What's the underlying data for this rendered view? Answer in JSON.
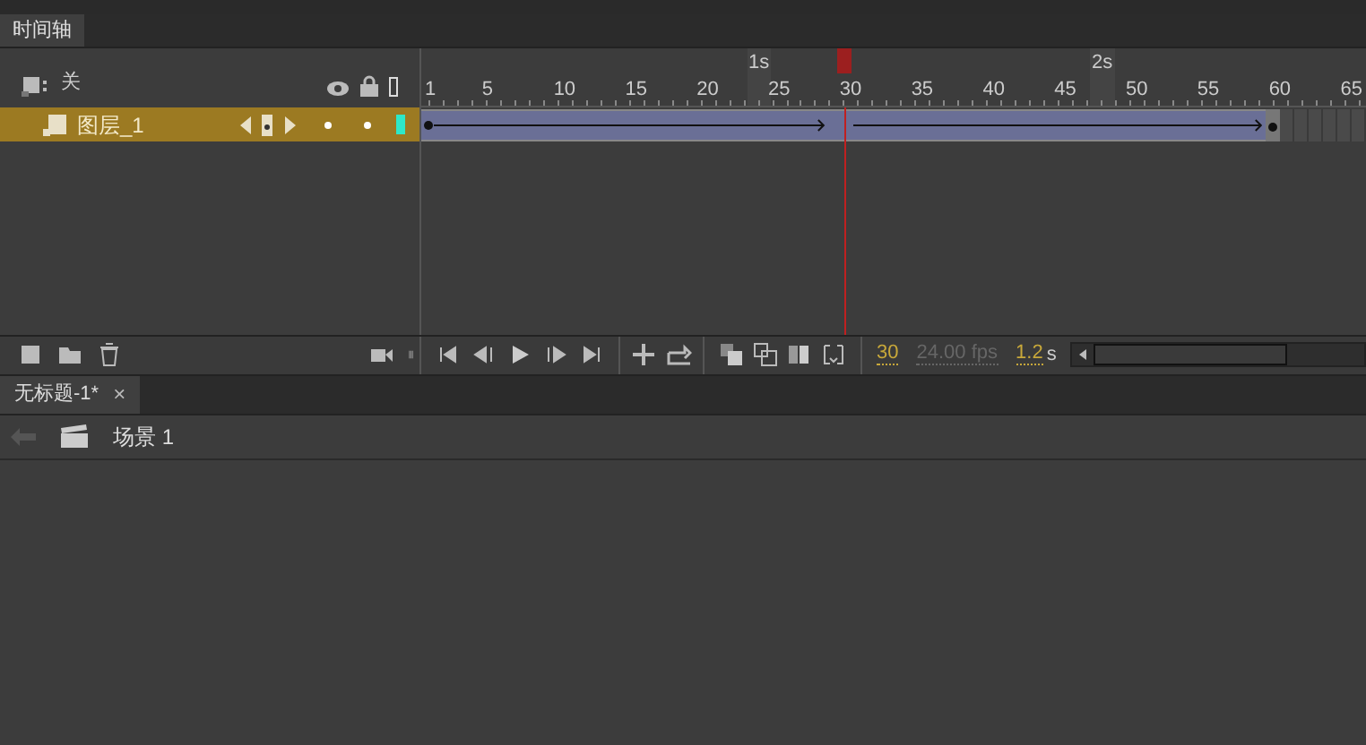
{
  "panel_tab": {
    "label": "时间轴",
    "selected": true
  },
  "layer_header": {
    "label": "关"
  },
  "layers": [
    {
      "name": "图层_1",
      "selected": true
    }
  ],
  "ruler": {
    "frame_labels": [
      "1",
      "5",
      "10",
      "15",
      "20",
      "25",
      "30",
      "35",
      "40",
      "45",
      "50",
      "55",
      "60",
      "65"
    ],
    "second_labels": [
      "1s",
      "2s"
    ]
  },
  "playhead": {
    "level": 0.448
  },
  "status": {
    "frame": "30",
    "fps": "24.00 fps",
    "time": "1.2",
    "time_unit": "s"
  },
  "document_tabs": [
    {
      "label": "无标题-1*",
      "selected": true,
      "close": "×"
    }
  ],
  "scene": {
    "label": "场景 1"
  }
}
